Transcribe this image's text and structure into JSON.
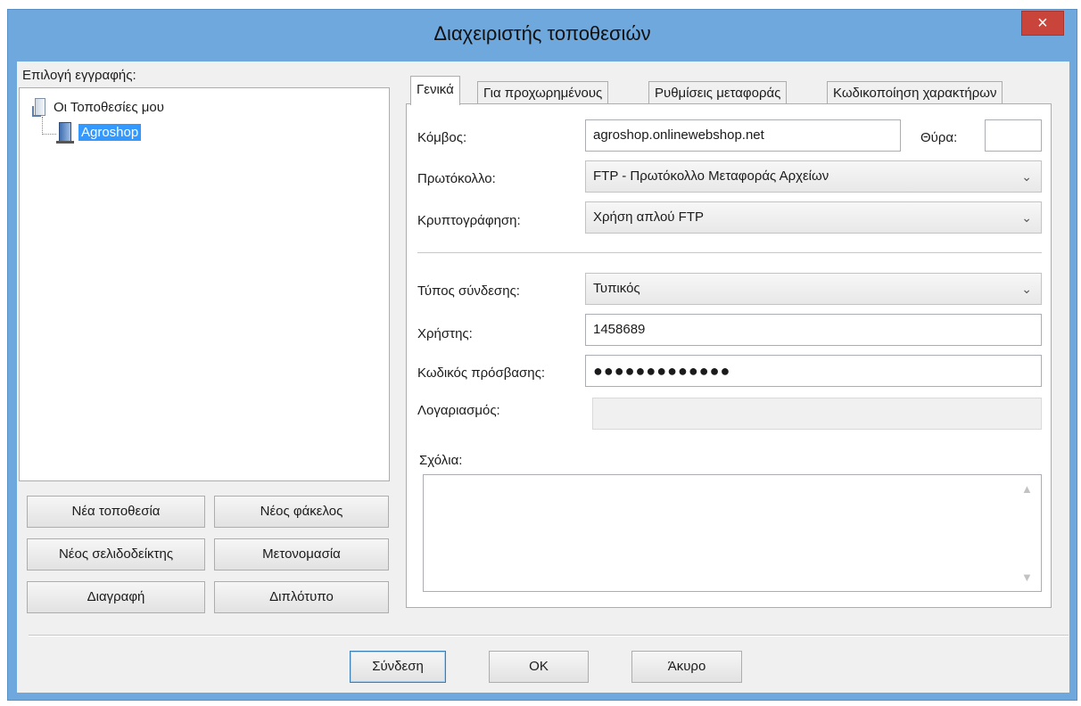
{
  "window": {
    "title": "Διαχειριστής τοποθεσιών",
    "close_glyph": "×"
  },
  "left": {
    "entry_label": "Επιλογή εγγραφής:",
    "tree": {
      "root": "Οι Τοποθεσίες μου",
      "child": "Agroshop"
    },
    "buttons": {
      "new_site": "Νέα τοποθεσία",
      "new_folder": "Νέος φάκελος",
      "new_bookmark": "Νέος σελιδοδείκτης",
      "rename": "Μετονομασία",
      "delete": "Διαγραφή",
      "duplicate": "Διπλότυπο"
    }
  },
  "tabs": [
    "Γενικά",
    "Για προχωρημένους",
    "Ρυθμίσεις μεταφοράς",
    "Κωδικοποίηση χαρακτήρων"
  ],
  "general": {
    "host_label": "Κόμβος:",
    "host_value": "agroshop.onlinewebshop.net",
    "port_label": "Θύρα:",
    "port_value": "",
    "protocol_label": "Πρωτόκολλο:",
    "protocol_value": "FTP - Πρωτόκολλο Μεταφοράς Αρχείων",
    "encryption_label": "Κρυπτογράφηση:",
    "encryption_value": "Χρήση απλού FTP",
    "logon_type_label": "Τύπος σύνδεσης:",
    "logon_type_value": "Τυπικός",
    "user_label": "Χρήστης:",
    "user_value": "1458689",
    "password_label": "Κωδικός πρόσβασης:",
    "password_mask": "●●●●●●●●●●●●●",
    "account_label": "Λογαριασμός:",
    "account_value": "",
    "comments_label": "Σχόλια:",
    "dropdown_glyph": "⌄"
  },
  "footer": {
    "connect": "Σύνδεση",
    "ok": "OK",
    "cancel": "Άκυρο"
  },
  "colors": {
    "titlebar": "#6fa8dc",
    "close": "#c9443a",
    "selection": "#3399ff"
  }
}
